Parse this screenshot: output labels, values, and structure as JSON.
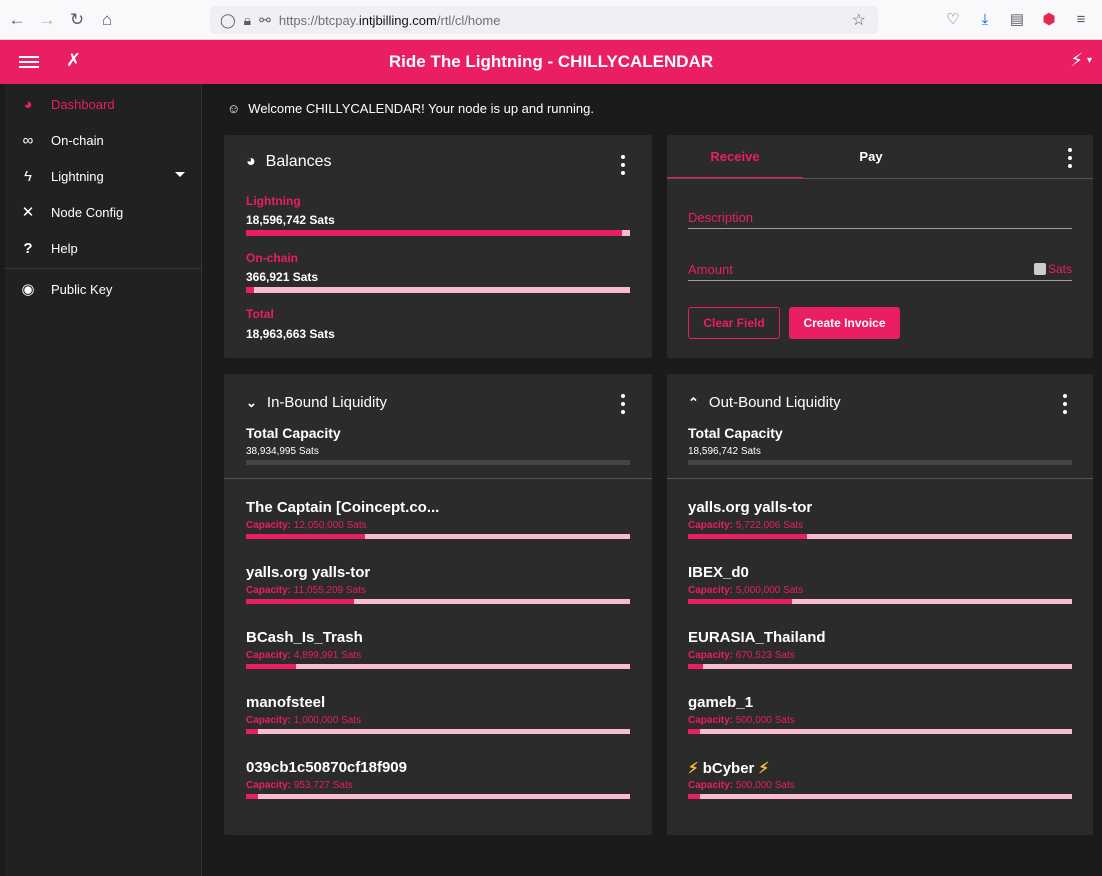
{
  "browser": {
    "url_prefix": "https://btcpay.",
    "url_host": "intjbilling.com",
    "url_path": "/rtl/cl/home"
  },
  "app": {
    "title": "Ride The Lightning - CHILLYCALENDAR",
    "accent": "#e91e63"
  },
  "sidebar": {
    "items": [
      {
        "label": "Dashboard",
        "icon": "speedometer-icon"
      },
      {
        "label": "On-chain",
        "icon": "link-icon"
      },
      {
        "label": "Lightning",
        "icon": "bolt-icon"
      },
      {
        "label": "Node Config",
        "icon": "tools-icon"
      },
      {
        "label": "Help",
        "icon": "question-icon"
      },
      {
        "label": "Public Key",
        "icon": "eye-icon"
      }
    ]
  },
  "welcome": "Welcome CHILLYCALENDAR! Your node is up and running.",
  "balances": {
    "title": "Balances",
    "lightning_label": "Lightning",
    "lightning_value": "18,596,742 Sats",
    "lightning_share": 0.98,
    "onchain_label": "On-chain",
    "onchain_value": "366,921 Sats",
    "onchain_share": 0.02,
    "total_label": "Total",
    "total_value": "18,963,663 Sats"
  },
  "invoice": {
    "tab_receive": "Receive",
    "tab_pay": "Pay",
    "description_placeholder": "Description",
    "amount_placeholder": "Amount",
    "amount_unit": "Sats",
    "clear_label": "Clear Field",
    "create_label": "Create Invoice"
  },
  "inbound": {
    "title": "In-Bound Liquidity",
    "total_label": "Total Capacity",
    "total_value": "38,934,995 Sats",
    "cap_prefix": "Capacity:",
    "peers": [
      {
        "name": "The Captain [Coincept.co...",
        "capacity": "12,050,000 Sats",
        "fill": 0.31
      },
      {
        "name": "yalls.org yalls-tor",
        "capacity": "11,055,209 Sats",
        "fill": 0.28
      },
      {
        "name": "BCash_Is_Trash",
        "capacity": "4,899,991 Sats",
        "fill": 0.13
      },
      {
        "name": "manofsteel",
        "capacity": "1,000,000 Sats",
        "fill": 0.03
      },
      {
        "name": "039cb1c50870cf18f909",
        "capacity": "953,727 Sats",
        "fill": 0.03
      }
    ]
  },
  "outbound": {
    "title": "Out-Bound Liquidity",
    "total_label": "Total Capacity",
    "total_value": "18,596,742 Sats",
    "cap_prefix": "Capacity:",
    "peers": [
      {
        "name": "yalls.org yalls-tor",
        "capacity": "5,722,006 Sats",
        "fill": 0.31
      },
      {
        "name": "IBEX_d0",
        "capacity": "5,000,000 Sats",
        "fill": 0.27
      },
      {
        "name": "EURASIA_Thailand",
        "capacity": "670,523 Sats",
        "fill": 0.04
      },
      {
        "name": "gameb_1",
        "capacity": "500,000 Sats",
        "fill": 0.03
      },
      {
        "name": "bCyber",
        "capacity": "500,000 Sats",
        "fill": 0.03
      }
    ]
  }
}
